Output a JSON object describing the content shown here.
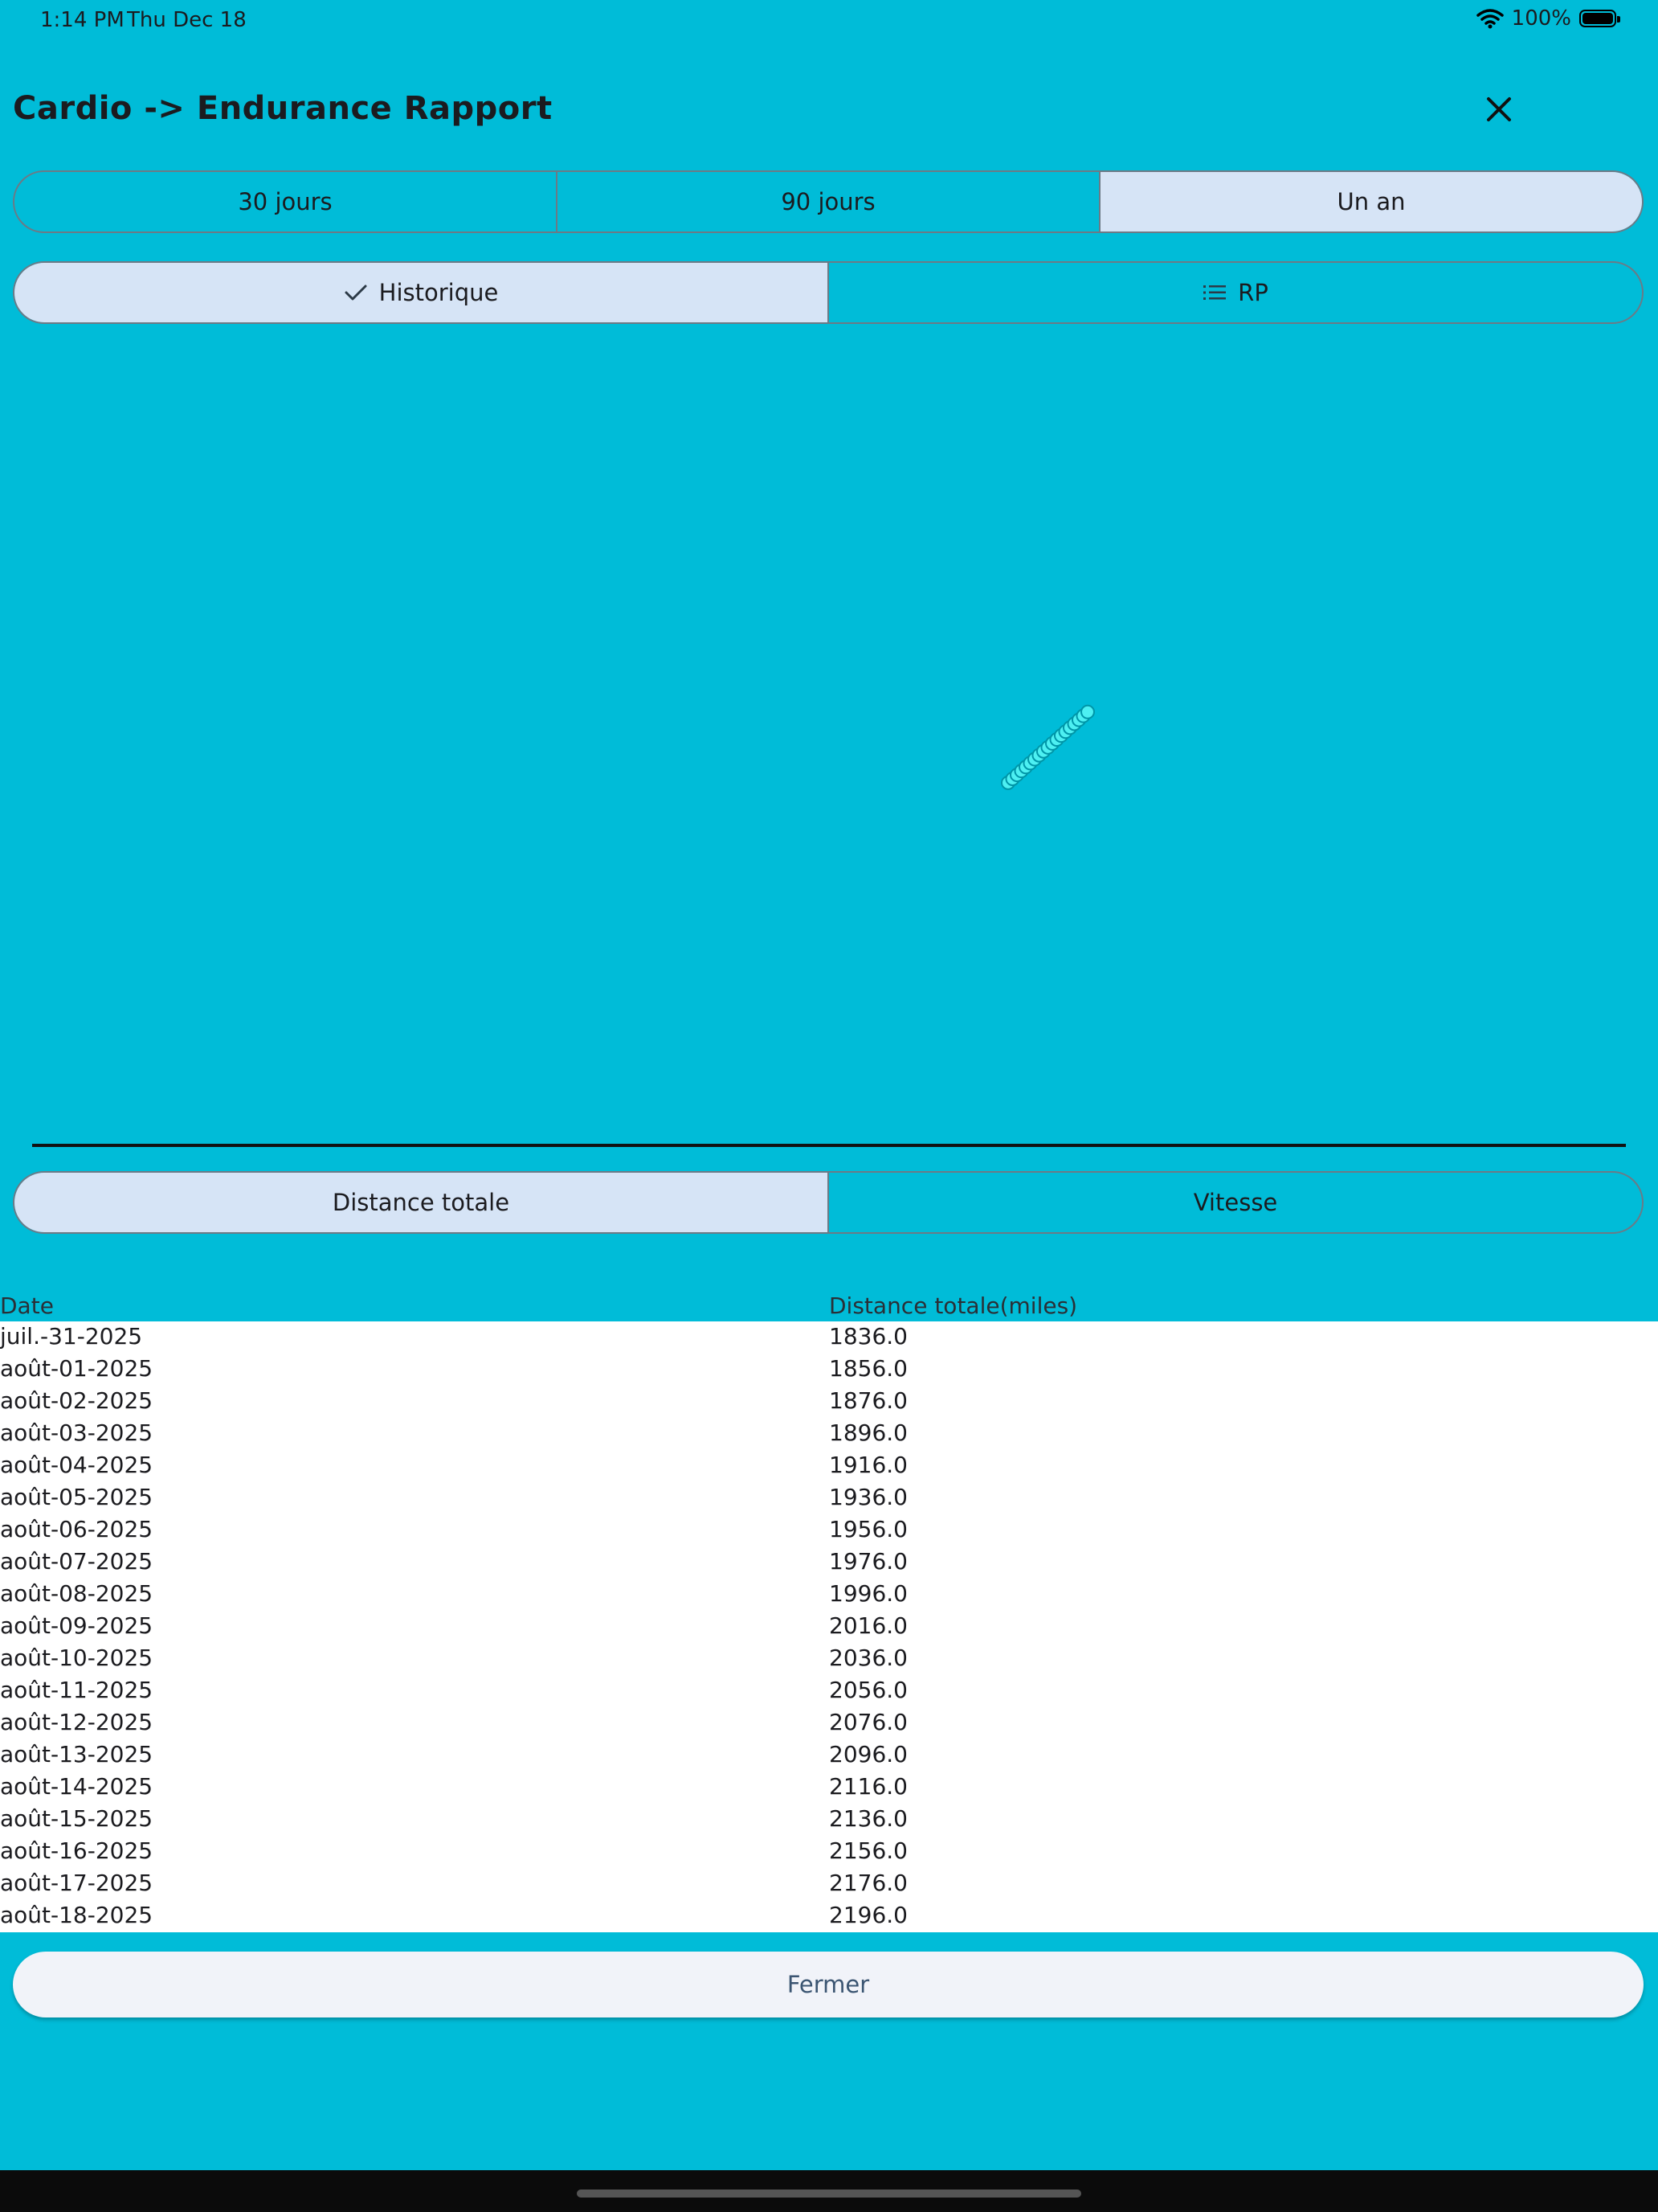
{
  "status": {
    "time": "1:14 PM",
    "date": "Thu Dec 18",
    "battery": "100%"
  },
  "header": {
    "title": "Cardio -> Endurance Rapport"
  },
  "range_tabs": [
    {
      "label": "30 jours",
      "selected": false
    },
    {
      "label": "90 jours",
      "selected": false
    },
    {
      "label": "Un an",
      "selected": true
    }
  ],
  "view_tabs": [
    {
      "label": "Historique",
      "icon": "check-icon",
      "selected": true
    },
    {
      "label": "RP",
      "icon": "list-icon",
      "selected": false
    }
  ],
  "metric_tabs": [
    {
      "label": "Distance totale",
      "selected": true
    },
    {
      "label": "Vitesse",
      "selected": false
    }
  ],
  "chart_data": {
    "type": "scatter",
    "x": [
      "juil.-31-2025",
      "août-01-2025",
      "août-02-2025",
      "août-03-2025",
      "août-04-2025",
      "août-05-2025",
      "août-06-2025",
      "août-07-2025",
      "août-08-2025",
      "août-09-2025",
      "août-10-2025",
      "août-11-2025",
      "août-12-2025",
      "août-13-2025",
      "août-14-2025",
      "août-15-2025",
      "août-16-2025",
      "août-17-2025",
      "août-18-2025"
    ],
    "y": [
      1836.0,
      1856.0,
      1876.0,
      1896.0,
      1916.0,
      1936.0,
      1956.0,
      1976.0,
      1996.0,
      2016.0,
      2036.0,
      2056.0,
      2076.0,
      2096.0,
      2116.0,
      2136.0,
      2156.0,
      2176.0,
      2196.0
    ],
    "point_color": "#4DF0F2",
    "point_stroke": "#0096A8",
    "grid": false
  },
  "table": {
    "headers": [
      "Date",
      "Distance totale(miles)"
    ],
    "rows": [
      [
        "juil.-31-2025",
        "1836.0"
      ],
      [
        "août-01-2025",
        "1856.0"
      ],
      [
        "août-02-2025",
        "1876.0"
      ],
      [
        "août-03-2025",
        "1896.0"
      ],
      [
        "août-04-2025",
        "1916.0"
      ],
      [
        "août-05-2025",
        "1936.0"
      ],
      [
        "août-06-2025",
        "1956.0"
      ],
      [
        "août-07-2025",
        "1976.0"
      ],
      [
        "août-08-2025",
        "1996.0"
      ],
      [
        "août-09-2025",
        "2016.0"
      ],
      [
        "août-10-2025",
        "2036.0"
      ],
      [
        "août-11-2025",
        "2056.0"
      ],
      [
        "août-12-2025",
        "2076.0"
      ],
      [
        "août-13-2025",
        "2096.0"
      ],
      [
        "août-14-2025",
        "2116.0"
      ],
      [
        "août-15-2025",
        "2136.0"
      ],
      [
        "août-16-2025",
        "2156.0"
      ],
      [
        "août-17-2025",
        "2176.0"
      ],
      [
        "août-18-2025",
        "2196.0"
      ]
    ]
  },
  "footer": {
    "close_label": "Fermer"
  }
}
